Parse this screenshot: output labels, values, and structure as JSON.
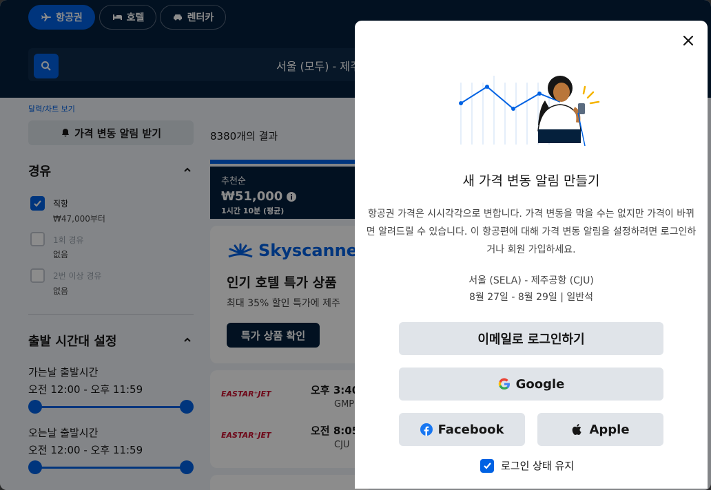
{
  "tabs": [
    {
      "label": "항공권",
      "icon": "plane-icon",
      "active": true
    },
    {
      "label": "호텔",
      "icon": "bed-icon",
      "active": false
    },
    {
      "label": "렌터카",
      "icon": "car-icon",
      "active": false
    }
  ],
  "search": {
    "route": "서울 (모두) - 제주"
  },
  "calendar_link": "달력/차트 보기",
  "alert_button": "가격 변동 알림 받기",
  "filters": {
    "stops": {
      "title": "경유",
      "options": [
        {
          "label": "직항",
          "sub": "₩47,000부터",
          "checked": true
        },
        {
          "label": "1회 경유",
          "sub": "없음",
          "checked": false
        },
        {
          "label": "2번 이상 경유",
          "sub": "없음",
          "checked": false
        }
      ]
    },
    "departure": {
      "title": "출발 시간대 설정",
      "outbound_label": "가는날 출발시간",
      "outbound_range": "오전 12:00 - 오후 11:59",
      "return_label": "오는날 출발시간",
      "return_range": "오전 12:00 - 오후 11:59"
    }
  },
  "results": {
    "count": "8380개의 결과",
    "sort": {
      "label": "추천순",
      "price": "₩51,000",
      "sub": "1시간 10분 (평균)"
    }
  },
  "ad": {
    "brand": "Skyscanner",
    "title": "인기 호텔 특가 상품",
    "subtitle": "최대 35% 할인 특가에 제주",
    "button": "특가 상품 확인"
  },
  "flights": [
    {
      "airline": "EASTAR⁺JET",
      "time": "오후 3:40",
      "code": "GMP"
    },
    {
      "airline": "EASTAR⁺JET",
      "time": "오전 8:05",
      "code": "CJU"
    }
  ],
  "modal": {
    "title": "새 가격 변동 알림 만들기",
    "description": "항공권 가격은 시시각각으로 변합니다. 가격 변동을 막을 수는 없지만 가격이 바뀌면 알려드릴 수 있습니다. 이 항공편에 대해 가격 변동 알림을 설정하려면 로그인하거나 회원 가입하세요.",
    "route": "서울 (SELA) - 제주공항 (CJU)",
    "dates": "8월 27일 - 8월 29일 | 일반석",
    "email_button": "이메일로 로그인하기",
    "google_button": "Google",
    "facebook_button": "Facebook",
    "apple_button": "Apple",
    "keep_signed_in": "로그인 상태 유지",
    "keep_checked": true
  },
  "colors": {
    "primary": "#0062e3",
    "navy": "#05203c"
  }
}
